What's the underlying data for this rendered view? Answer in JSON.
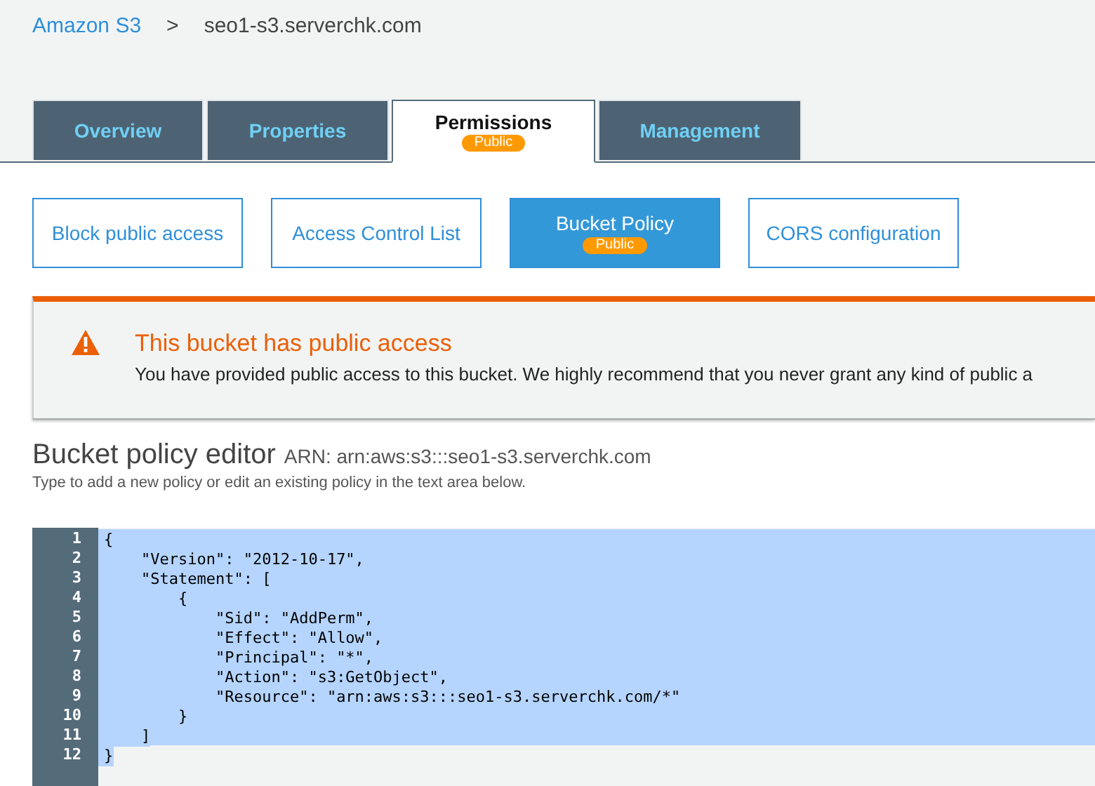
{
  "breadcrumb": {
    "root": "Amazon S3",
    "separator": ">",
    "current": "seo1-s3.serverchk.com"
  },
  "tabs": [
    {
      "label": "Overview",
      "selected": false
    },
    {
      "label": "Properties",
      "selected": false
    },
    {
      "label": "Permissions",
      "selected": true,
      "badge": "Public"
    },
    {
      "label": "Management",
      "selected": false
    }
  ],
  "subtabs": [
    {
      "label": "Block public access",
      "selected": false
    },
    {
      "label": "Access Control List",
      "selected": false
    },
    {
      "label": "Bucket Policy",
      "selected": true,
      "badge": "Public"
    },
    {
      "label": "CORS configuration",
      "selected": false
    }
  ],
  "alert": {
    "title": "This bucket has public access",
    "message": "You have provided public access to this bucket. We highly recommend that you never grant any kind of public a"
  },
  "editor": {
    "title": "Bucket policy editor",
    "arn": "ARN: arn:aws:s3:::seo1-s3.serverchk.com",
    "hint": "Type to add a new policy or edit an existing policy in the text area below.",
    "lines": [
      {
        "number": "1",
        "text": "{",
        "selected": true
      },
      {
        "number": "2",
        "text": "    \"Version\": \"2012-10-17\",",
        "selected": true
      },
      {
        "number": "3",
        "text": "    \"Statement\": [",
        "selected": true
      },
      {
        "number": "4",
        "text": "        {",
        "selected": true
      },
      {
        "number": "5",
        "text": "            \"Sid\": \"AddPerm\",",
        "selected": true
      },
      {
        "number": "6",
        "text": "            \"Effect\": \"Allow\",",
        "selected": true
      },
      {
        "number": "7",
        "text": "            \"Principal\": \"*\",",
        "selected": true
      },
      {
        "number": "8",
        "text": "            \"Action\": \"s3:GetObject\",",
        "selected": true
      },
      {
        "number": "9",
        "text": "            \"Resource\": \"arn:aws:s3:::seo1-s3.serverchk.com/*\"",
        "selected": true
      },
      {
        "number": "10",
        "text": "        }",
        "selected": true
      },
      {
        "number": "11",
        "text": "    ]",
        "selected": true
      },
      {
        "number": "12",
        "text": "}",
        "selected": true
      }
    ]
  }
}
